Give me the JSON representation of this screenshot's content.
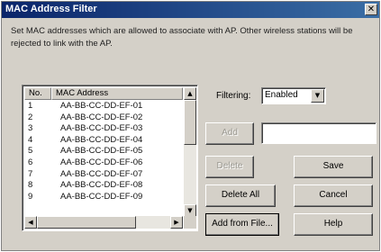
{
  "dialog": {
    "title": "MAC Address Filter",
    "close_glyph": "✕",
    "description": "Set MAC addresses which are allowed to associate with AP. Other wireless stations will be rejected to link with the AP."
  },
  "list": {
    "columns": [
      "No.",
      "MAC Address"
    ],
    "rows": [
      {
        "no": "1",
        "mac": "AA-BB-CC-DD-EF-01"
      },
      {
        "no": "2",
        "mac": "AA-BB-CC-DD-EF-02"
      },
      {
        "no": "3",
        "mac": "AA-BB-CC-DD-EF-03"
      },
      {
        "no": "4",
        "mac": "AA-BB-CC-DD-EF-04"
      },
      {
        "no": "5",
        "mac": "AA-BB-CC-DD-EF-05"
      },
      {
        "no": "6",
        "mac": "AA-BB-CC-DD-EF-06"
      },
      {
        "no": "7",
        "mac": "AA-BB-CC-DD-EF-07"
      },
      {
        "no": "8",
        "mac": "AA-BB-CC-DD-EF-08"
      },
      {
        "no": "9",
        "mac": "AA-BB-CC-DD-EF-09"
      }
    ]
  },
  "filtering": {
    "label": "Filtering:",
    "value": "Enabled"
  },
  "mac_input": {
    "value": ""
  },
  "buttons": {
    "add": "Add",
    "delete": "Delete",
    "save": "Save",
    "delete_all": "Delete All",
    "cancel": "Cancel",
    "add_from_file": "Add from File...",
    "help": "Help"
  },
  "icons": {
    "scroll_up": "▲",
    "scroll_down": "▼",
    "scroll_left": "◀",
    "scroll_right": "▶",
    "dropdown": "▼"
  },
  "colors": {
    "titlebar_start": "#0a246a",
    "titlebar_end": "#3a6ea5",
    "face": "#d4d0c8"
  }
}
